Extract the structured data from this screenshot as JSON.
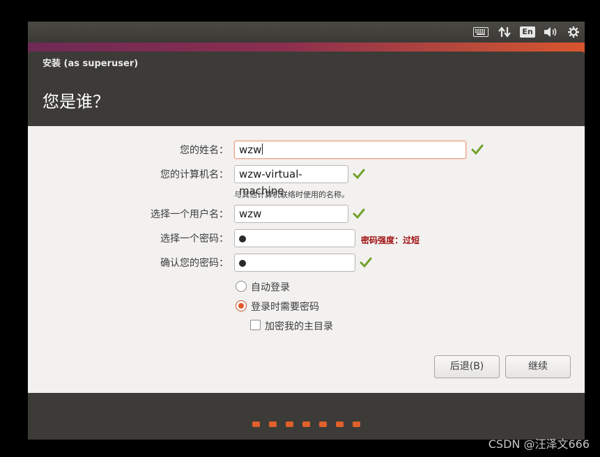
{
  "top_panel": {
    "icons": [
      "keyboard-icon",
      "network-arrows-icon",
      "language-indicator-icon",
      "volume-icon",
      "gear-icon"
    ],
    "language": "En"
  },
  "window": {
    "title": "安装 (as superuser)",
    "heading": "您是谁？"
  },
  "form": {
    "name_label": "您的姓名：",
    "name_value": "wzw",
    "computer_label": "您的计算机名：",
    "computer_value": "wzw-virtual-machine",
    "computer_hint": "与其他计算机联络时使用的名称。",
    "username_label": "选择一个用户名：",
    "username_value": "wzw",
    "password_label": "选择一个密码：",
    "password_strength": "密码强度：过短",
    "confirm_label": "确认您的密码："
  },
  "login_options": {
    "auto_login": "自动登录",
    "require_password": "登录时需要密码",
    "selected": "require_password",
    "encrypt_home": "加密我的主目录",
    "encrypt_home_checked": false
  },
  "buttons": {
    "back": "后退(B)",
    "continue": "继续"
  },
  "progress": {
    "steps": 7
  },
  "colors": {
    "accent": "#e05a2b",
    "check": "#73a12b",
    "strength_warning": "#a01010"
  },
  "watermark": "CSDN @汪泽文666"
}
